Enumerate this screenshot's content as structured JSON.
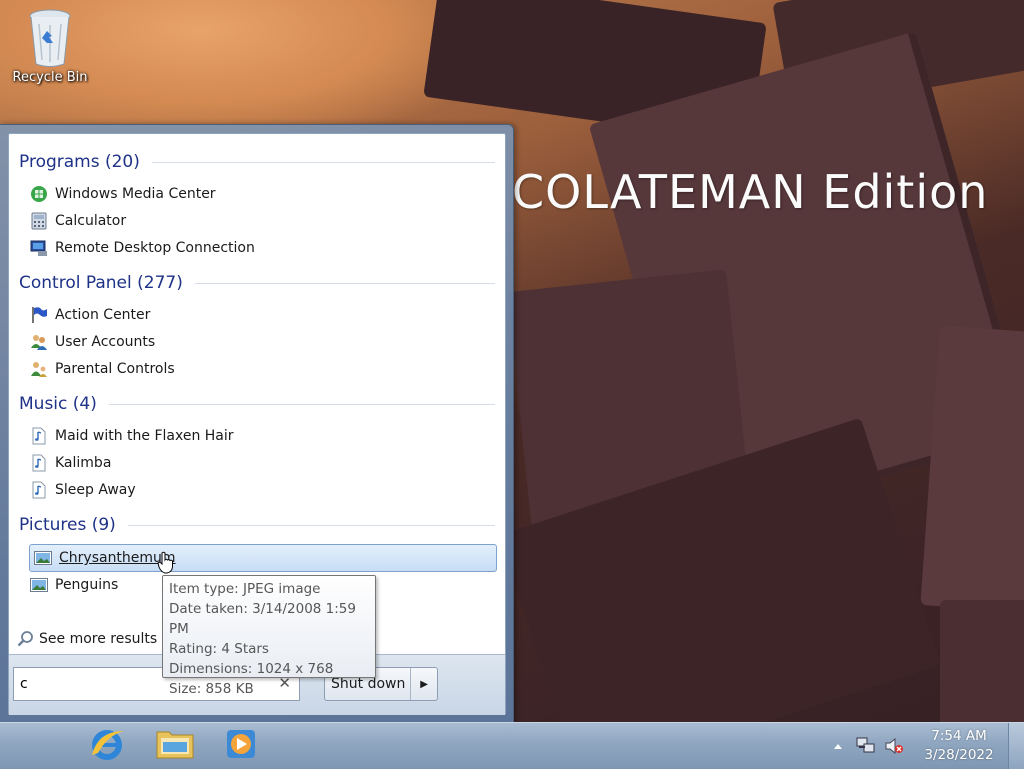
{
  "desktop": {
    "recycle_bin_label": "Recycle Bin",
    "wallpaper_text": "COLATEMAN Edition"
  },
  "start_menu": {
    "groups": [
      {
        "title": "Programs (20)",
        "items": [
          {
            "label": "Windows Media Center",
            "icon": "windows-media-center-icon"
          },
          {
            "label": "Calculator",
            "icon": "calculator-icon"
          },
          {
            "label": "Remote Desktop Connection",
            "icon": "remote-desktop-icon"
          }
        ]
      },
      {
        "title": "Control Panel (277)",
        "items": [
          {
            "label": "Action Center",
            "icon": "action-center-flag-icon"
          },
          {
            "label": "User Accounts",
            "icon": "user-accounts-icon"
          },
          {
            "label": "Parental Controls",
            "icon": "parental-controls-icon"
          }
        ]
      },
      {
        "title": "Music (4)",
        "items": [
          {
            "label": "Maid with the Flaxen Hair",
            "icon": "music-file-icon"
          },
          {
            "label": "Kalimba",
            "icon": "music-file-icon"
          },
          {
            "label": "Sleep Away",
            "icon": "music-file-icon"
          }
        ]
      },
      {
        "title": "Pictures (9)",
        "items": [
          {
            "label": "Chrysanthemum",
            "icon": "picture-file-icon",
            "selected": true
          },
          {
            "label": "Penguins",
            "icon": "picture-file-icon"
          }
        ]
      }
    ],
    "see_more_label": "See more results",
    "search": {
      "value": "c",
      "clear_icon": "clear-x-icon"
    },
    "shutdown_label": "Shut down",
    "shutdown_arrow_icon": "arrow-right-icon"
  },
  "tooltip": {
    "item_type": "Item type: JPEG image",
    "date_taken": "Date taken: 3/14/2008 1:59 PM",
    "rating": "Rating: 4 Stars",
    "dimensions": "Dimensions: 1024 x 768",
    "size": "Size: 858 KB"
  },
  "taskbar": {
    "pinned": [
      {
        "name": "internet-explorer",
        "icon": "internet-explorer-icon"
      },
      {
        "name": "windows-explorer",
        "icon": "folder-icon"
      },
      {
        "name": "windows-media-player",
        "icon": "media-player-icon"
      }
    ],
    "tray": {
      "show_hidden_icon": "chevron-up-icon",
      "network_icon": "network-icon",
      "volume_icon": "volume-muted-icon"
    },
    "clock": {
      "time": "7:54 AM",
      "date": "3/28/2022"
    }
  },
  "colors": {
    "group_header": "#1e3287",
    "taskbar": "#8fa6c0",
    "selection_border": "#7da2ce"
  }
}
